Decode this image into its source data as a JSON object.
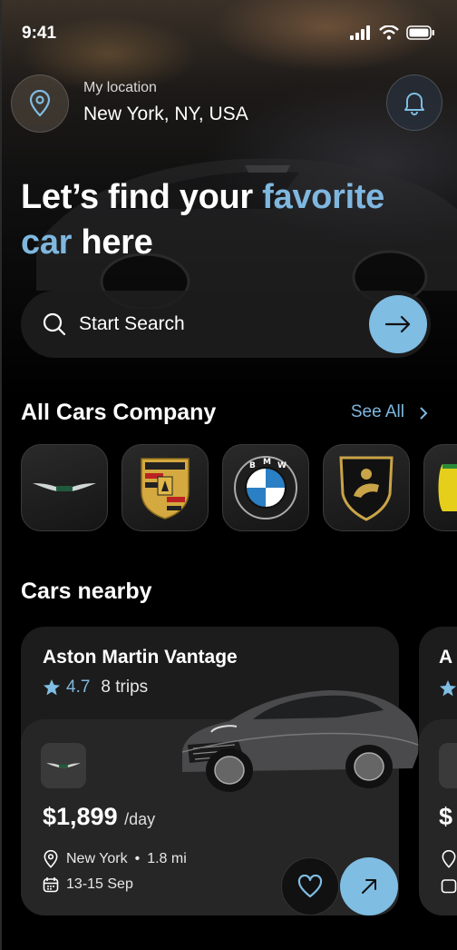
{
  "status": {
    "time": "9:41"
  },
  "location": {
    "label": "My location",
    "value": "New York, NY, USA"
  },
  "headline": {
    "part1": "Let’s find your ",
    "accent1": "favorite",
    "accent2": "car",
    "part2": " here"
  },
  "search": {
    "placeholder": "Start Search"
  },
  "companies": {
    "title": "All Cars Company",
    "see_all": "See All",
    "brands": [
      "Aston Martin",
      "Porsche",
      "BMW",
      "Lamborghini",
      "Ferrari"
    ]
  },
  "nearby": {
    "title": "Cars nearby",
    "cards": [
      {
        "name": "Aston Martin Vantage",
        "rating": "4.7",
        "trips": "8 trips",
        "price": "$1,899",
        "per": "/day",
        "location": "New York",
        "distance": "1.8 mi",
        "dates": "13-15 Sep"
      }
    ],
    "peek_initial": "A",
    "peek_price_char": "$"
  },
  "colors": {
    "accent": "#7fbde3",
    "accent_text": "#7fb7df",
    "card": "#1c1c1c",
    "card_inner": "#262626"
  },
  "icons": {
    "status": [
      "signal-icon",
      "wifi-icon",
      "battery-icon"
    ],
    "location": "map-pin-icon",
    "bell": "bell-icon",
    "search": "search-icon",
    "go": "arrow-right-icon",
    "rating": "star-icon",
    "fav": "heart-icon",
    "open": "arrow-up-right-icon",
    "calendar": "calendar-icon"
  }
}
